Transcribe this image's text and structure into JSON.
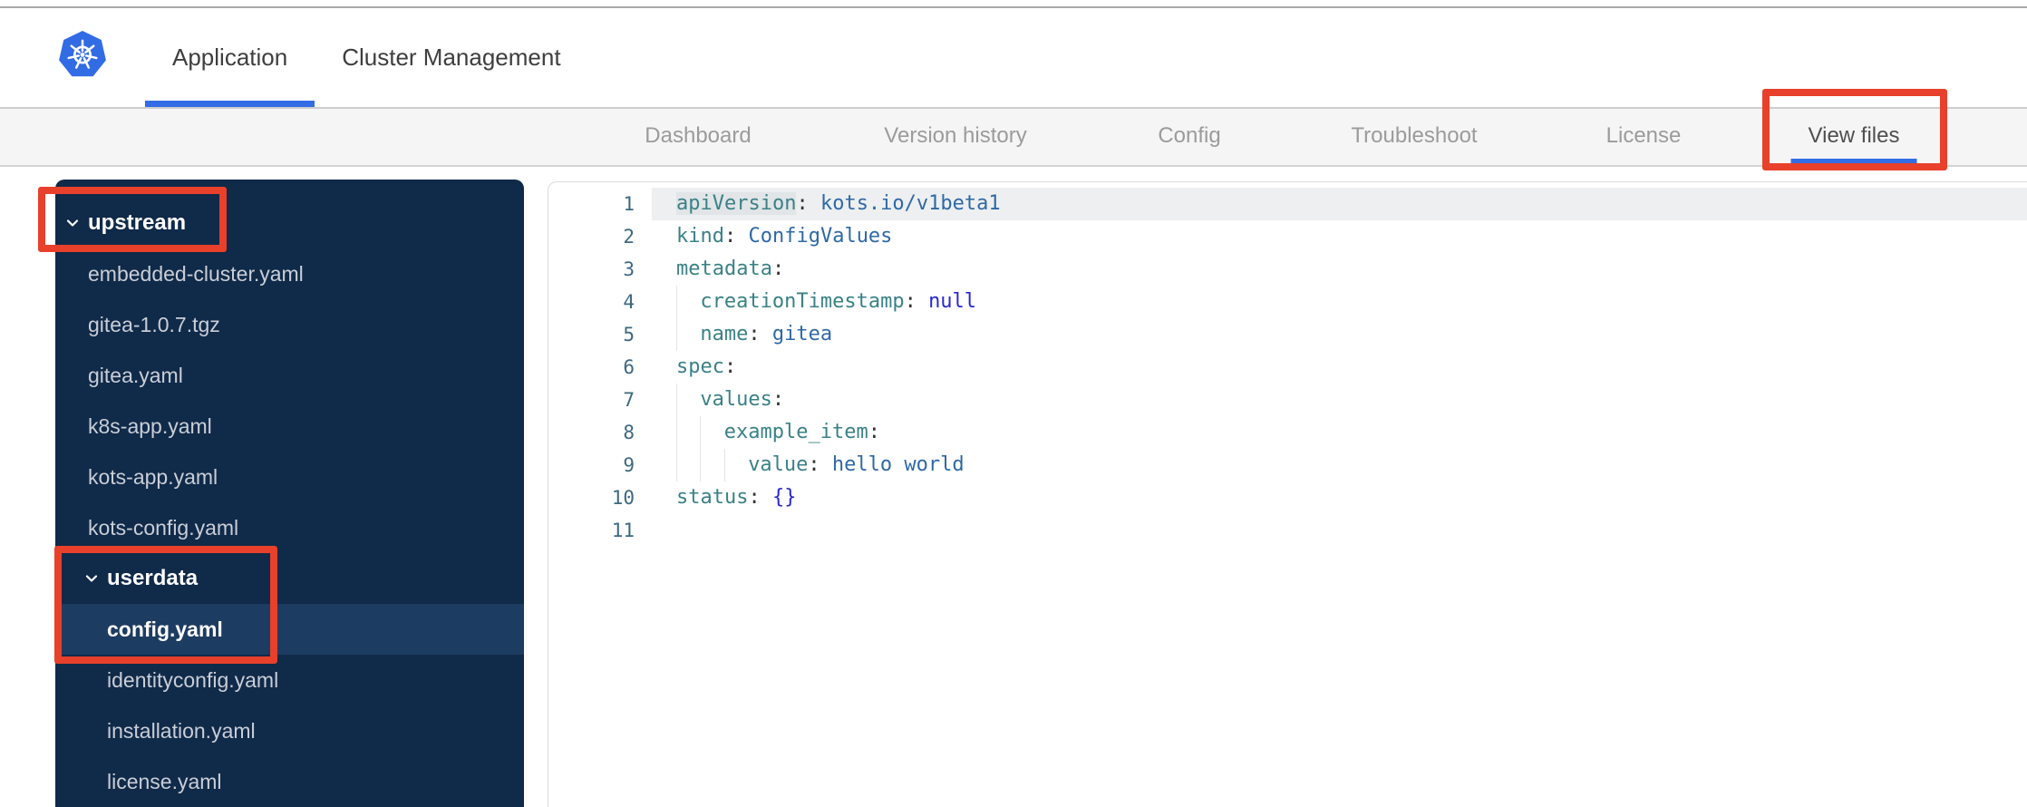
{
  "header": {
    "logo_icon": "kubernetes-logo",
    "tabs": [
      {
        "id": "application",
        "label": "Application",
        "active": true
      },
      {
        "id": "cluster-management",
        "label": "Cluster Management",
        "active": false
      }
    ]
  },
  "subnav": {
    "items": [
      {
        "id": "dashboard",
        "label": "Dashboard",
        "active": false
      },
      {
        "id": "version-history",
        "label": "Version history",
        "active": false
      },
      {
        "id": "config",
        "label": "Config",
        "active": false
      },
      {
        "id": "troubleshoot",
        "label": "Troubleshoot",
        "active": false
      },
      {
        "id": "license",
        "label": "License",
        "active": false
      },
      {
        "id": "view-files",
        "label": "View files",
        "active": true
      }
    ]
  },
  "file_tree": {
    "items": [
      {
        "label": "upstream",
        "kind": "folder",
        "level": 1,
        "expanded": true
      },
      {
        "label": "embedded-cluster.yaml",
        "kind": "file",
        "level": 1
      },
      {
        "label": "gitea-1.0.7.tgz",
        "kind": "file",
        "level": 1
      },
      {
        "label": "gitea.yaml",
        "kind": "file",
        "level": 1
      },
      {
        "label": "k8s-app.yaml",
        "kind": "file",
        "level": 1
      },
      {
        "label": "kots-app.yaml",
        "kind": "file",
        "level": 1
      },
      {
        "label": "kots-config.yaml",
        "kind": "file",
        "level": 1
      },
      {
        "label": "userdata",
        "kind": "folder",
        "level": 2,
        "expanded": true
      },
      {
        "label": "config.yaml",
        "kind": "file",
        "level": 2,
        "selected": true
      },
      {
        "label": "identityconfig.yaml",
        "kind": "file",
        "level": 2
      },
      {
        "label": "installation.yaml",
        "kind": "file",
        "level": 2
      },
      {
        "label": "license.yaml",
        "kind": "file",
        "level": 2
      }
    ]
  },
  "editor": {
    "language": "yaml",
    "lines": [
      {
        "num": "1",
        "active": true,
        "indent": 0,
        "tokens": [
          {
            "c": "key",
            "t": "apiVersion",
            "highlight": true
          },
          {
            "c": "punct",
            "t": ": "
          },
          {
            "c": "val",
            "t": "kots.io/v1beta1"
          }
        ]
      },
      {
        "num": "2",
        "indent": 0,
        "tokens": [
          {
            "c": "key",
            "t": "kind"
          },
          {
            "c": "punct",
            "t": ": "
          },
          {
            "c": "val",
            "t": "ConfigValues"
          }
        ]
      },
      {
        "num": "3",
        "indent": 0,
        "tokens": [
          {
            "c": "key",
            "t": "metadata"
          },
          {
            "c": "punct",
            "t": ":"
          }
        ]
      },
      {
        "num": "4",
        "indent": 2,
        "tokens": [
          {
            "c": "key",
            "t": "creationTimestamp"
          },
          {
            "c": "punct",
            "t": ": "
          },
          {
            "c": "lit",
            "t": "null"
          }
        ]
      },
      {
        "num": "5",
        "indent": 2,
        "tokens": [
          {
            "c": "key",
            "t": "name"
          },
          {
            "c": "punct",
            "t": ": "
          },
          {
            "c": "val",
            "t": "gitea"
          }
        ]
      },
      {
        "num": "6",
        "indent": 0,
        "tokens": [
          {
            "c": "key",
            "t": "spec"
          },
          {
            "c": "punct",
            "t": ":"
          }
        ]
      },
      {
        "num": "7",
        "indent": 2,
        "tokens": [
          {
            "c": "key",
            "t": "values"
          },
          {
            "c": "punct",
            "t": ":"
          }
        ]
      },
      {
        "num": "8",
        "indent": 4,
        "tokens": [
          {
            "c": "key",
            "t": "example_item"
          },
          {
            "c": "punct",
            "t": ":"
          }
        ]
      },
      {
        "num": "9",
        "indent": 6,
        "tokens": [
          {
            "c": "key",
            "t": "value"
          },
          {
            "c": "punct",
            "t": ": "
          },
          {
            "c": "val",
            "t": "hello world"
          }
        ]
      },
      {
        "num": "10",
        "indent": 0,
        "tokens": [
          {
            "c": "key",
            "t": "status"
          },
          {
            "c": "punct",
            "t": ": "
          },
          {
            "c": "lit",
            "t": "{}"
          }
        ]
      },
      {
        "num": "11",
        "indent": 0,
        "tokens": []
      }
    ]
  },
  "annotations": {
    "color": "#e8402a",
    "boxes": [
      {
        "target": "view-files-tab"
      },
      {
        "target": "upstream-folder"
      },
      {
        "target": "userdata-config-yaml"
      }
    ]
  },
  "colors": {
    "accent_blue": "#326de6",
    "sidebar_bg": "#102a49",
    "sidebar_selected_bg": "#1d3c61",
    "annotation_red": "#e8402a",
    "yaml_key": "#3a8186",
    "yaml_value": "#2f68a6",
    "yaml_literal": "#2727d4"
  }
}
